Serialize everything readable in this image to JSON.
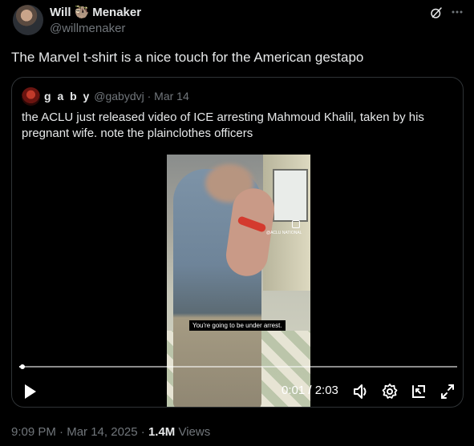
{
  "author": {
    "name_first": "Will",
    "name_emoji": "🦥",
    "name_last": "Menaker",
    "handle": "@willmenaker"
  },
  "tweet": {
    "text": "The Marvel t-shirt is a nice touch for the American gestapo"
  },
  "quoted": {
    "name": "g a b y",
    "handle": "@gabydvj",
    "separator": "·",
    "date": "Mar 14",
    "text_line1": "the ACLU just released video of ICE arresting Mahmoud Khalil, taken by his",
    "text_line2": "pregnant wife. note the plainclothes officers",
    "video": {
      "caption": "You're going to be under arrest.",
      "watermark": "@ACLU NATIONAL",
      "time_label": "0:01 / 2:03",
      "progress": 0.008
    }
  },
  "meta": {
    "time": "9:09 PM",
    "sep1": "·",
    "date": "Mar 14, 2025",
    "sep2": "·",
    "views": "1.4M",
    "views_label": "Views"
  },
  "icons": {
    "grok": "grok-icon",
    "more": "more-icon",
    "play": "play-icon",
    "volume": "volume-icon",
    "settings": "gear-icon",
    "pip": "pip-icon",
    "fullscreen": "fullscreen-icon"
  },
  "colors": {
    "background": "#000000",
    "text": "#e7e9ea",
    "secondary": "#71767b",
    "border": "#2f3336"
  }
}
